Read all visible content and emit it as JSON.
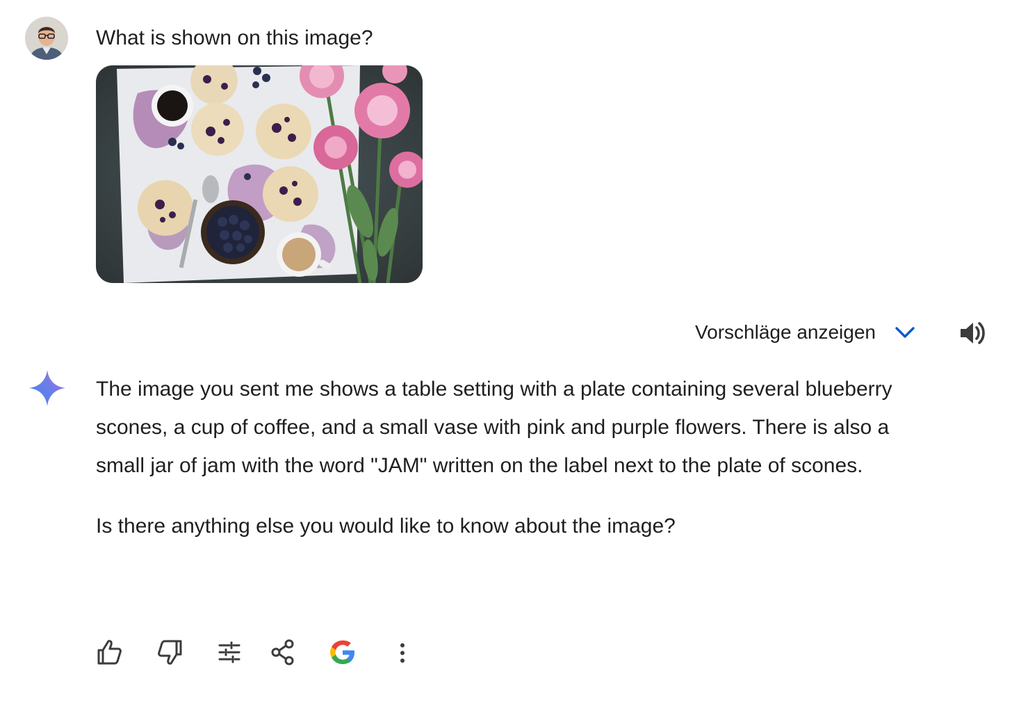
{
  "user": {
    "prompt": "What is shown on this image?",
    "avatar_icon": "user-avatar"
  },
  "uploaded_image": {
    "description_icon": "photo-thumbnail"
  },
  "suggestions": {
    "label": "Vorschläge anzeigen",
    "chevron_icon": "chevron-down-icon",
    "chevron_color": "#0b57d0"
  },
  "speaker_icon": "volume-icon",
  "response": {
    "paragraphs": [
      "The image you sent me shows a table setting with a plate containing several blueberry scones, a cup of coffee, and a small vase with pink and purple flowers. There is also a small jar of jam with the word \"JAM\" written on the label next to the plate of scones.",
      "Is there anything else you would like to know about the image?"
    ]
  },
  "actions": [
    {
      "icon": "thumbs-up-icon"
    },
    {
      "icon": "thumbs-down-icon"
    },
    {
      "icon": "tune-icon"
    },
    {
      "icon": "share-icon"
    },
    {
      "icon": "google-icon"
    },
    {
      "icon": "more-vert-icon"
    }
  ]
}
